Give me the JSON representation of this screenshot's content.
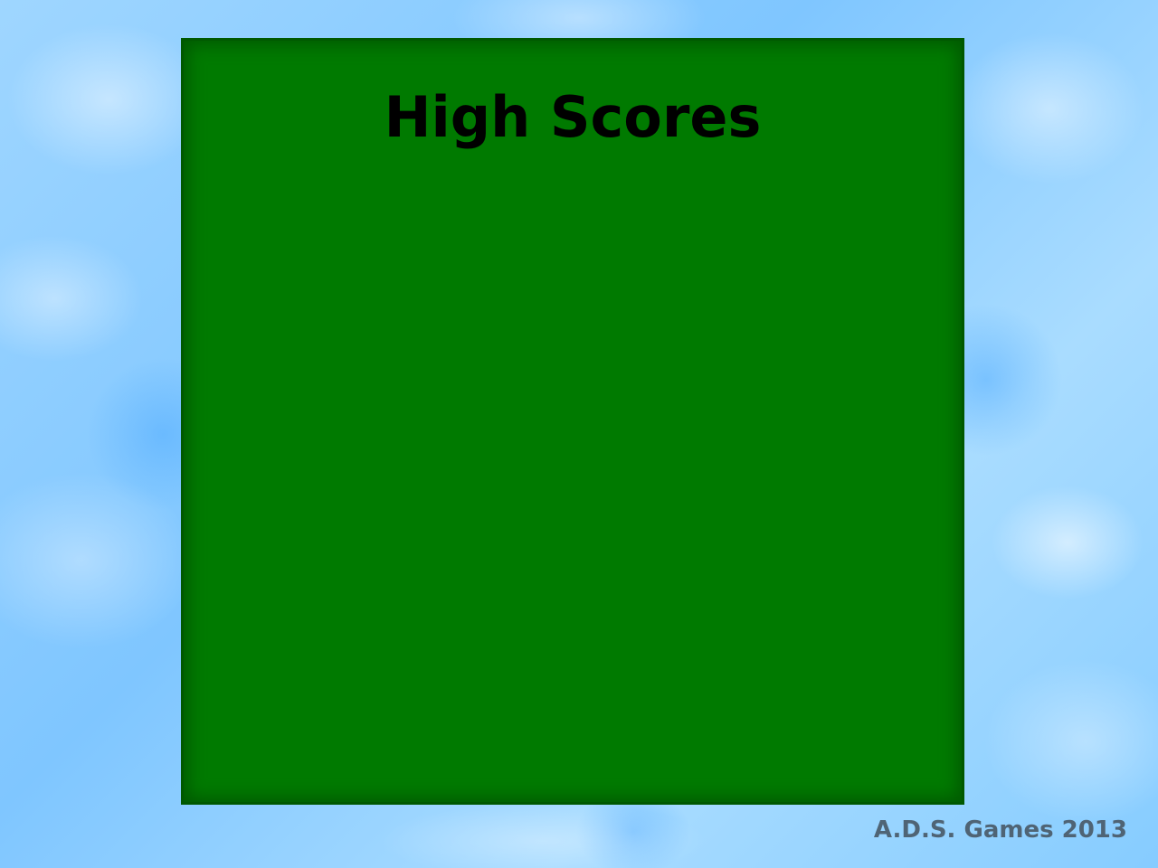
{
  "screen": {
    "title": "High Scores",
    "credit": "A.D.S. Games 2013"
  },
  "colors": {
    "sky": "#8fd0ff",
    "panel": "#007a00",
    "panel_border": "#005800",
    "title_text": "#000000",
    "credit_text": "#4f6475"
  }
}
